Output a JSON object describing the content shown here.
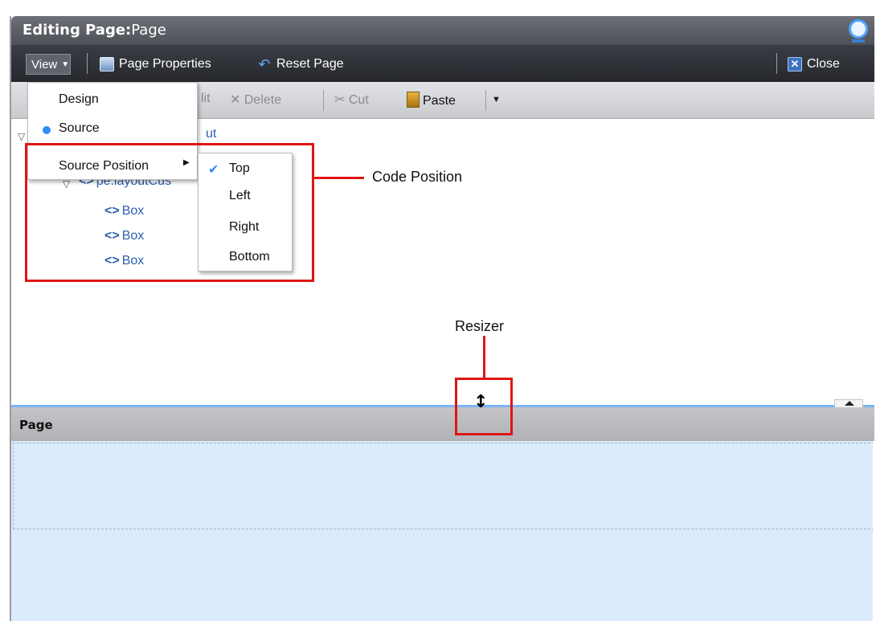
{
  "title_bar": {
    "prefix": "Editing Page:",
    "name": "Page"
  },
  "toolbar": {
    "view_label": "View",
    "page_properties_label": "Page Properties",
    "reset_page_label": "Reset Page",
    "close_label": "Close"
  },
  "toolbar2": {
    "edit_label": "lit",
    "delete_label": "Delete",
    "cut_label": "Cut",
    "paste_label": "Paste"
  },
  "tree": {
    "root_label": "ut",
    "layout_label": "pe:layoutCus",
    "boxes": [
      "Box",
      "Box",
      "Box"
    ]
  },
  "view_menu": {
    "design_label": "Design",
    "source_label": "Source",
    "source_position_label": "Source Position"
  },
  "source_position_menu": {
    "items": [
      "Top",
      "Left",
      "Right",
      "Bottom"
    ],
    "selected": "Top"
  },
  "annotations": {
    "code_position": "Code Position",
    "resizer": "Resizer"
  },
  "page_panel": {
    "header": "Page"
  },
  "icons": [
    "oracle-logo",
    "page-properties-icon",
    "reset-icon",
    "close-icon",
    "delete-icon",
    "cut-icon",
    "paste-icon",
    "check-icon",
    "resize-icon"
  ],
  "colors": {
    "accent": "#2f8cff",
    "annotation_red": "#e01515",
    "page_body": "#dcebfb"
  }
}
